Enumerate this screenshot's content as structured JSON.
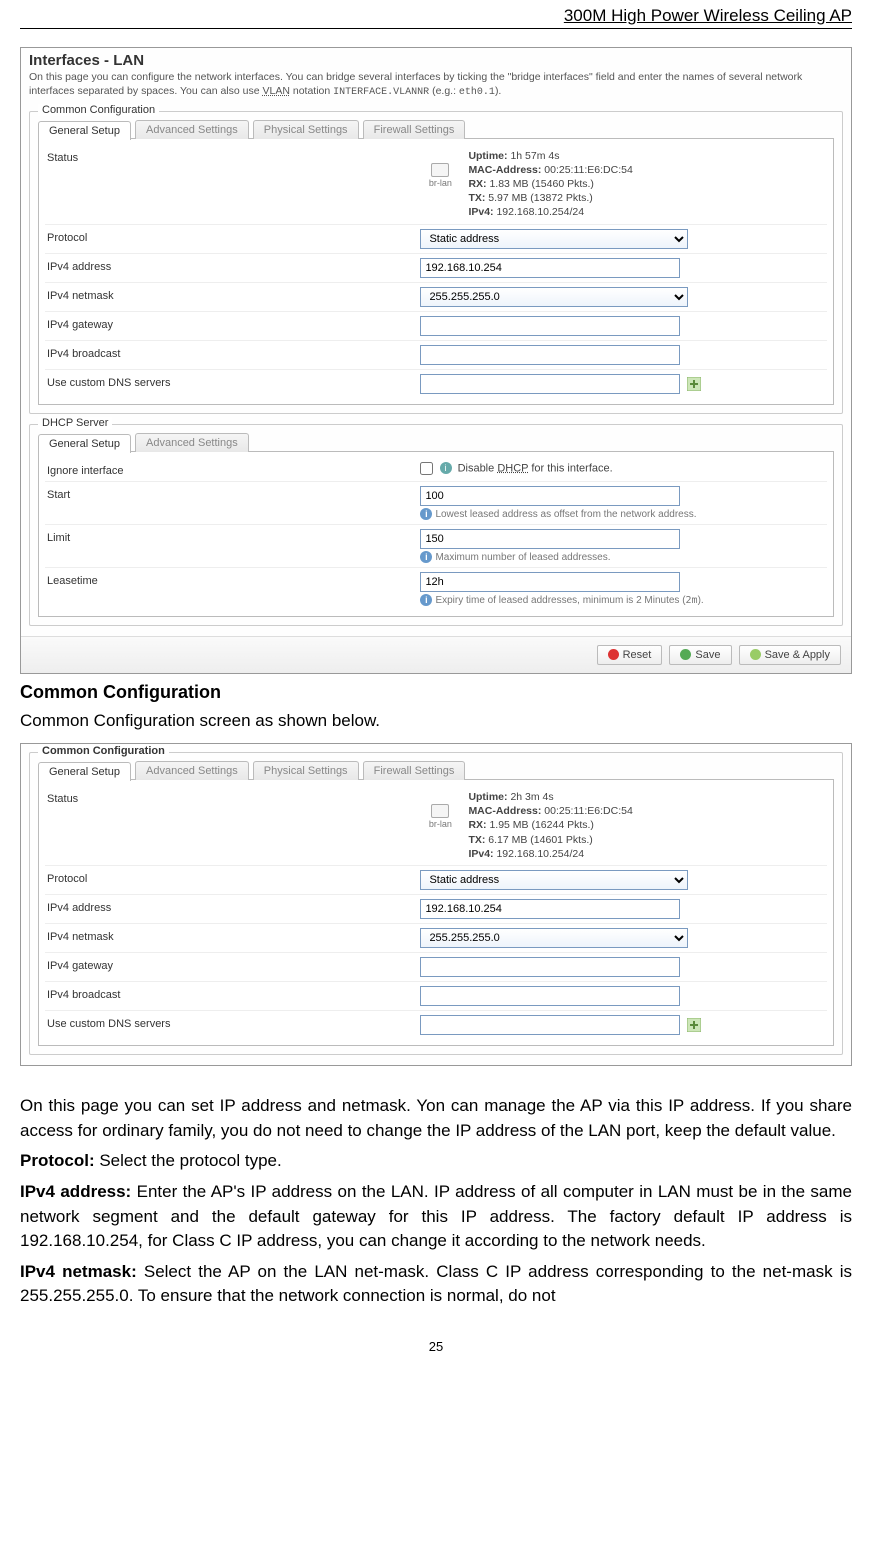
{
  "header": {
    "title": "300M High Power Wireless Ceiling AP"
  },
  "pageNum": "25",
  "shot1": {
    "title": "Interfaces - LAN",
    "desc_pre": "On this page you can configure the network interfaces. You can bridge several interfaces by ticking the \"bridge interfaces\" field and enter the names of several network interfaces separated by spaces. You can also use ",
    "desc_vlan": "VLAN",
    "desc_mid": " notation ",
    "desc_code": "INTERFACE.VLANNR",
    "desc_eg": " (e.g.: ",
    "desc_eg2": "eth0.1",
    "desc_end": ").",
    "common": {
      "legend": "Common Configuration",
      "tabs": [
        "General Setup",
        "Advanced Settings",
        "Physical Settings",
        "Firewall Settings"
      ],
      "rows": {
        "status_label": "Status",
        "brlan": "br-lan",
        "uptime_l": "Uptime:",
        "uptime_v": "1h 57m 4s",
        "mac_l": "MAC-Address:",
        "mac_v": "00:25:11:E6:DC:54",
        "rx_l": "RX:",
        "rx_v": "1.83 MB (15460 Pkts.)",
        "tx_l": "TX:",
        "tx_v": "5.97 MB (13872 Pkts.)",
        "ipv4s_l": "IPv4:",
        "ipv4s_v": "192.168.10.254/24",
        "protocol_l": "Protocol",
        "protocol_v": "Static address",
        "ipv4addr_l": "IPv4 address",
        "ipv4addr_v": "192.168.10.254",
        "netmask_l": "IPv4 netmask",
        "netmask_v": "255.255.255.0",
        "gateway_l": "IPv4 gateway",
        "gateway_v": "",
        "broadcast_l": "IPv4 broadcast",
        "broadcast_v": "",
        "dns_l": "Use custom DNS servers",
        "dns_v": ""
      }
    },
    "dhcp": {
      "legend": "DHCP Server",
      "tabs": [
        "General Setup",
        "Advanced Settings"
      ],
      "ignore_l": "Ignore interface",
      "ignore_hint": "Disable DHCP for this interface.",
      "start_l": "Start",
      "start_v": "100",
      "start_hint": "Lowest leased address as offset from the network address.",
      "limit_l": "Limit",
      "limit_v": "150",
      "limit_hint": "Maximum number of leased addresses.",
      "lease_l": "Leasetime",
      "lease_v": "12h",
      "lease_hint_pre": "Expiry time of leased addresses, minimum is 2 Minutes (",
      "lease_hint_code": "2m",
      "lease_hint_post": ")."
    },
    "buttons": {
      "reset": "Reset",
      "save": "Save",
      "saveapply": "Save & Apply"
    }
  },
  "shot2": {
    "legend": "Common Configuration",
    "tabs": [
      "General Setup",
      "Advanced Settings",
      "Physical Settings",
      "Firewall Settings"
    ],
    "rows": {
      "status_label": "Status",
      "brlan": "br-lan",
      "uptime_l": "Uptime:",
      "uptime_v": "2h 3m 4s",
      "mac_l": "MAC-Address:",
      "mac_v": "00:25:11:E6:DC:54",
      "rx_l": "RX:",
      "rx_v": "1.95 MB (16244 Pkts.)",
      "tx_l": "TX:",
      "tx_v": "6.17 MB (14601 Pkts.)",
      "ipv4s_l": "IPv4:",
      "ipv4s_v": "192.168.10.254/24",
      "protocol_l": "Protocol",
      "protocol_v": "Static address",
      "ipv4addr_l": "IPv4 address",
      "ipv4addr_v": "192.168.10.254",
      "netmask_l": "IPv4 netmask",
      "netmask_v": "255.255.255.0",
      "gateway_l": "IPv4 gateway",
      "gateway_v": "",
      "broadcast_l": "IPv4 broadcast",
      "broadcast_v": "",
      "dns_l": "Use custom DNS servers",
      "dns_v": ""
    }
  },
  "doc": {
    "h2": "Common Configuration",
    "sub": "Common Configuration screen as shown below.",
    "p1": "On this page you can set IP address and netmask. Yon can manage the AP via this IP address. If you share access for ordinary family, you do not need to change the IP address of the LAN port, keep the default value.",
    "p2b": "Protocol:",
    "p2": " Select the protocol type.",
    "p3b": "IPv4 address:",
    "p3": " Enter the AP's IP address on the LAN. IP address of all computer in LAN must be in the same network segment and the default gateway for this IP address. The factory default IP address is 192.168.10.254, for Class C IP address, you can change it according to the network needs.",
    "p4b": "IPv4 netmask:",
    "p4": " Select the AP on the LAN net-mask. Class C IP address corresponding to the net-mask is 255.255.255.0. To ensure that the network connection is normal, do not"
  }
}
